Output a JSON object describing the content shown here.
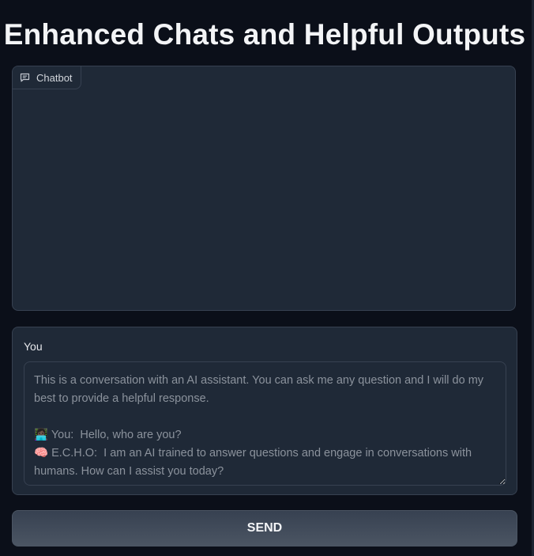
{
  "page": {
    "title": "Enhanced Chats and Helpful Outputs"
  },
  "chatbot": {
    "label": "Chatbot",
    "icon": "chat-bubble-icon"
  },
  "input": {
    "label": "You",
    "value": "This is a conversation with an AI assistant. You can ask me any question and I will do my best to provide a helpful response.\n\n👩🏿‍💻 You:  Hello, who are you?\n🧠 E.C.H.O:  I am an AI trained to answer questions and engage in conversations with humans. How can I assist you today?"
  },
  "actions": {
    "send_label": "SEND"
  },
  "colors": {
    "background": "#0b0f19",
    "panel": "#1f2937",
    "border": "#374151",
    "button_top": "#374151",
    "button_bottom": "#4b5563"
  }
}
